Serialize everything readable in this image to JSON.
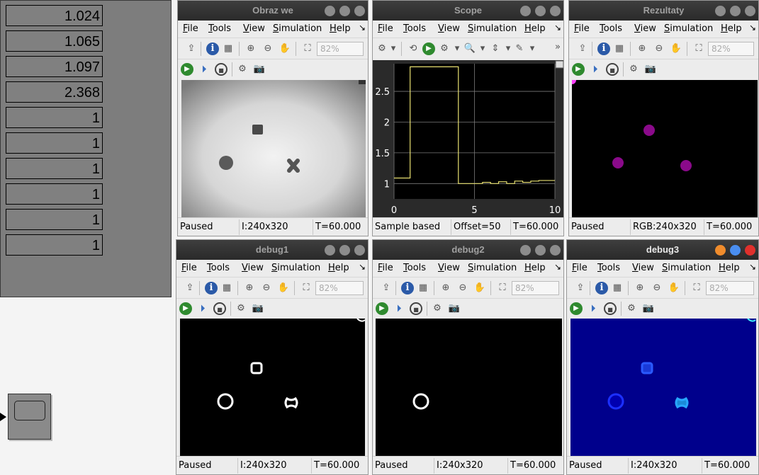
{
  "display_values": [
    "1.024",
    "1.065",
    "1.097",
    "2.368",
    "1",
    "1",
    "1",
    "1",
    "1",
    "1"
  ],
  "menu": {
    "file": "File",
    "tools": "Tools",
    "view": "View",
    "simulation": "Simulation",
    "help": "Help",
    "more": "↘"
  },
  "toolbar": {
    "zoom": "82%"
  },
  "windows": {
    "obraz_we": {
      "title": "Obraz we",
      "status": [
        "Paused",
        "I:240x320",
        "T=60.000"
      ]
    },
    "scope": {
      "title": "Scope",
      "status": [
        "Sample based",
        "Offset=50",
        "T=60.000"
      ]
    },
    "rezultaty": {
      "title": "Rezultaty",
      "status": [
        "Paused",
        "RGB:240x320",
        "T=60.000"
      ]
    },
    "debug1": {
      "title": "debug1",
      "status": [
        "Paused",
        "I:240x320",
        "T=60.000"
      ]
    },
    "debug2": {
      "title": "debug2",
      "status": [
        "Paused",
        "I:240x320",
        "T=60.000"
      ]
    },
    "debug3": {
      "title": "debug3",
      "status": [
        "Paused",
        "I:240x320",
        "T=60.000"
      ]
    }
  },
  "chart_data": {
    "type": "line",
    "title": "",
    "xlabel": "",
    "ylabel": "",
    "x_ticks": [
      "0",
      "5",
      "10"
    ],
    "y_ticks": [
      "1",
      "1.5",
      "2",
      "2.5"
    ],
    "xlim": [
      0,
      10
    ],
    "ylim": [
      0.75,
      2.95
    ],
    "grid": true,
    "series": [
      {
        "color": "#e8e070",
        "step": true,
        "x": [
          0,
          1,
          1,
          4,
          4,
          5,
          5.5,
          6,
          6.5,
          7,
          7.5,
          8,
          8.5,
          9,
          10
        ],
        "y": [
          1.09,
          1.09,
          2.9,
          2.9,
          1.0,
          1.0,
          1.02,
          1.0,
          1.03,
          1.0,
          1.04,
          1.02,
          1.04,
          1.05,
          1.05
        ]
      }
    ],
    "colors": {
      "background": "#000000",
      "grid": "#7a7a7a",
      "axes": "#2a2a2a",
      "tick_text": "#ffffff",
      "line": "#e8e070"
    }
  },
  "colors": {
    "panel": "#7d7d7d",
    "titlebar": "#333333",
    "debug3_bg": "#00008c",
    "rezultaty_blob": "#8a0a8a",
    "magenta_corner": "#ff40ff"
  }
}
